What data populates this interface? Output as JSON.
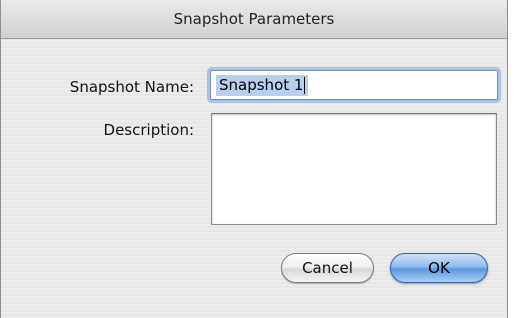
{
  "dialog": {
    "title": "Snapshot Parameters"
  },
  "form": {
    "name_label": "Snapshot Name:",
    "name_value": "Snapshot 1",
    "description_label": "Description:",
    "description_value": ""
  },
  "buttons": {
    "cancel_label": "Cancel",
    "ok_label": "OK"
  },
  "colors": {
    "focus_ring": "#a9c3e8",
    "selection": "#b7d0f0",
    "default_button": "#5c97e0"
  }
}
